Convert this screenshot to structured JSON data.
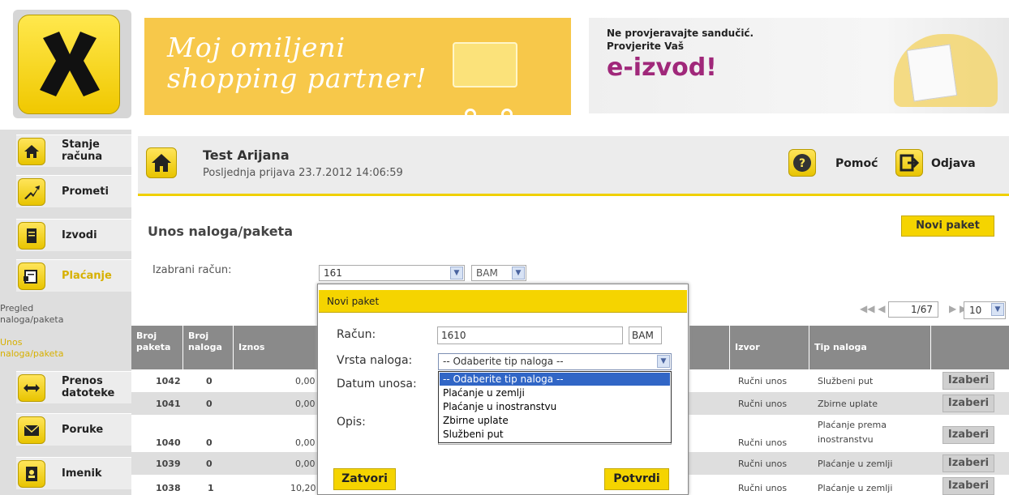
{
  "banner1": {
    "line1": "Moj omiljeni",
    "line2": "shopping partner!"
  },
  "banner2": {
    "line1": "Ne provjeravajte sandučić.",
    "line2": "Provjerite Vaš",
    "line3": "e-izvod!"
  },
  "sidebar": {
    "items": [
      {
        "label1": "Stanje",
        "label2": "računa"
      },
      {
        "label1": "Prometi"
      },
      {
        "label1": "Izvodi"
      },
      {
        "label1": "Plaćanje"
      },
      {
        "label1": "Prenos",
        "label2": "datoteke"
      },
      {
        "label1": "Poruke"
      },
      {
        "label1": "Imenik"
      }
    ],
    "sub": [
      {
        "label1": "Pregled",
        "label2": "naloga/paketa"
      },
      {
        "label1": "Unos",
        "label2": "naloga/paketa"
      }
    ]
  },
  "user": {
    "name": "Test Arijana",
    "last_login": "Posljednja prijava 23.7.2012 14:06:59"
  },
  "header": {
    "help": "Pomoć",
    "logout": "Odjava"
  },
  "page": {
    "title": "Unos naloga/paketa",
    "new_package": "Novi paket"
  },
  "account": {
    "label": "Izabrani račun:",
    "value": "161",
    "currency": "BAM"
  },
  "pager": {
    "page": "1/67",
    "per_page": "10"
  },
  "table": {
    "headers": [
      {
        "l1": "Broj",
        "l2": "paketa"
      },
      {
        "l1": "Broj",
        "l2": "naloga"
      },
      {
        "l1": "Iznos"
      },
      {
        "l1": "Izvor"
      },
      {
        "l1": "Tip naloga"
      }
    ],
    "select_label": "Izaberi",
    "rows": [
      {
        "paket": "1042",
        "nalog": "0",
        "iznos": "0,00",
        "izvor": "Ručni unos",
        "tip": "Službeni put"
      },
      {
        "paket": "1041",
        "nalog": "0",
        "iznos": "0,00",
        "izvor": "Ručni unos",
        "tip": "Zbirne uplate"
      },
      {
        "paket": "1040",
        "nalog": "0",
        "iznos": "0,00",
        "izvor": "Ručni unos",
        "tip": "Plaćanje prema",
        "tip2": "inostranstvu"
      },
      {
        "paket": "1039",
        "nalog": "0",
        "iznos": "0,00",
        "izvor": "Ručni unos",
        "tip": "Plaćanje u zemlji"
      },
      {
        "paket": "1038",
        "nalog": "1",
        "iznos": "10,20",
        "izvor": "Ručni unos",
        "tip": "Plaćanje u zemlji"
      }
    ]
  },
  "modal": {
    "title": "Novi paket",
    "racun_label": "Račun:",
    "racun_value": "1610",
    "currency": "BAM",
    "vrsta_label": "Vrsta naloga:",
    "vrsta_value": "-- Odaberite tip naloga --",
    "datum_label": "Datum unosa:",
    "opis_label": "Opis:",
    "options": [
      "-- Odaberite tip naloga --",
      "Plaćanje u zemlji",
      "Plaćanje u inostranstvu",
      "Zbirne uplate",
      "Službeni put"
    ],
    "close": "Zatvori",
    "confirm": "Potvrdi"
  }
}
